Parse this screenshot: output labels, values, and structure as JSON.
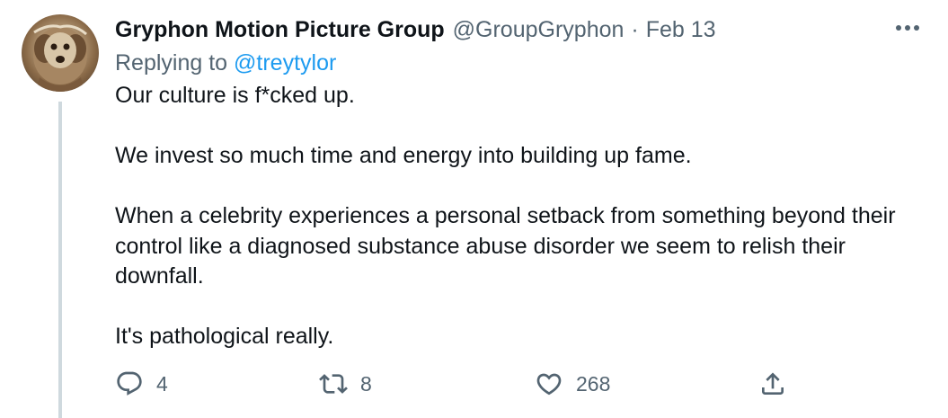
{
  "tweet": {
    "author": {
      "display_name": "Gryphon Motion Picture Group",
      "handle": "@GroupGryphon"
    },
    "separator": "·",
    "date": "Feb 13",
    "replying_prefix": "Replying to",
    "replying_to": "@treytylor",
    "paragraphs": [
      "Our culture is f*cked up.",
      "We invest so much time and energy into building up fame.",
      "When a celebrity experiences a personal setback from something beyond their control like a diagnosed substance abuse disorder we seem to relish their downfall.",
      "It's pathological really."
    ],
    "actions": {
      "reply_count": "4",
      "retweet_count": "8",
      "like_count": "268"
    }
  },
  "icons": {
    "more": "more-horizontal-icon",
    "reply": "reply-icon",
    "retweet": "retweet-icon",
    "like": "heart-icon",
    "share": "share-icon"
  },
  "colors": {
    "text_primary": "#0f1419",
    "text_secondary": "#536471",
    "link": "#1d9bf0",
    "thread_line": "#cfd9de"
  }
}
